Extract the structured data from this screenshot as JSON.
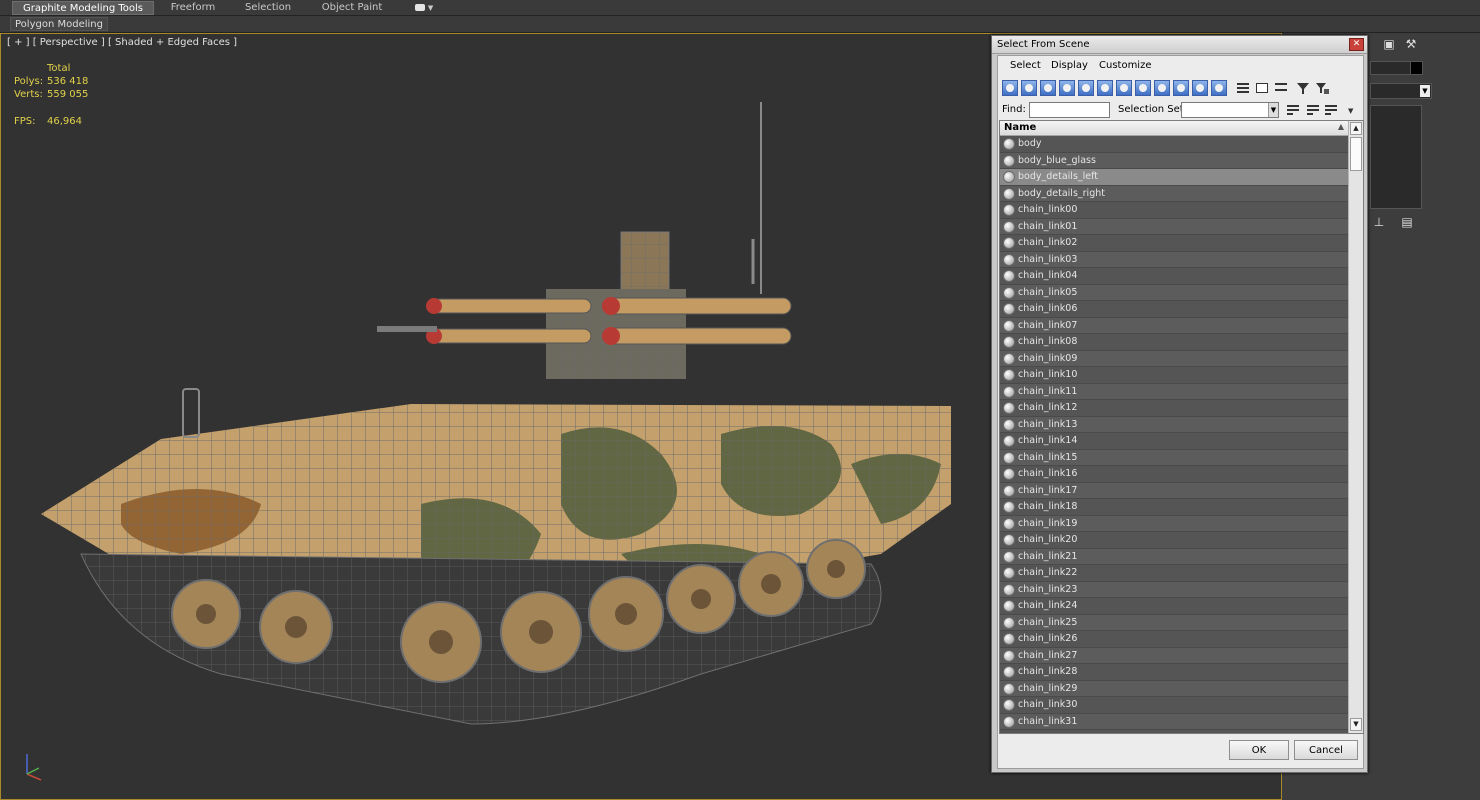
{
  "ribbon": {
    "tabs": [
      "Graphite Modeling Tools",
      "Freeform",
      "Selection",
      "Object Paint"
    ],
    "sub_label": "Polygon Modeling"
  },
  "viewport": {
    "label": "[ + ] [ Perspective ] [ Shaded + Edged Faces ]",
    "stats": {
      "total_label": "Total",
      "polys_label": "Polys:",
      "polys_value": "536 418",
      "verts_label": "Verts:",
      "verts_value": "559 055",
      "fps_label": "FPS:",
      "fps_value": "46,964"
    },
    "colors": {
      "stats": "#e1d14a",
      "border": "#a8892a"
    }
  },
  "dialog": {
    "title": "Select From Scene",
    "close_glyph": "✕",
    "menu": [
      "Select",
      "Display",
      "Customize"
    ],
    "find_label": "Find:",
    "find_value": "",
    "selection_set_label": "Selection Set:",
    "selection_set_value": "",
    "column_header": "Name",
    "sort_glyph": "▲",
    "scroll_up": "▲",
    "scroll_down": "▼",
    "dropdown_glyph": "▼",
    "items": [
      "body",
      "body_blue_glass",
      "body_details_left",
      "body_details_right",
      "chain_link00",
      "chain_link01",
      "chain_link02",
      "chain_link03",
      "chain_link04",
      "chain_link05",
      "chain_link06",
      "chain_link07",
      "chain_link08",
      "chain_link09",
      "chain_link10",
      "chain_link11",
      "chain_link12",
      "chain_link13",
      "chain_link14",
      "chain_link15",
      "chain_link16",
      "chain_link17",
      "chain_link18",
      "chain_link19",
      "chain_link20",
      "chain_link21",
      "chain_link22",
      "chain_link23",
      "chain_link24",
      "chain_link25",
      "chain_link26",
      "chain_link27",
      "chain_link28",
      "chain_link29",
      "chain_link30",
      "chain_link31"
    ],
    "selected_item": "body_details_left",
    "ok_label": "OK",
    "cancel_label": "Cancel"
  }
}
